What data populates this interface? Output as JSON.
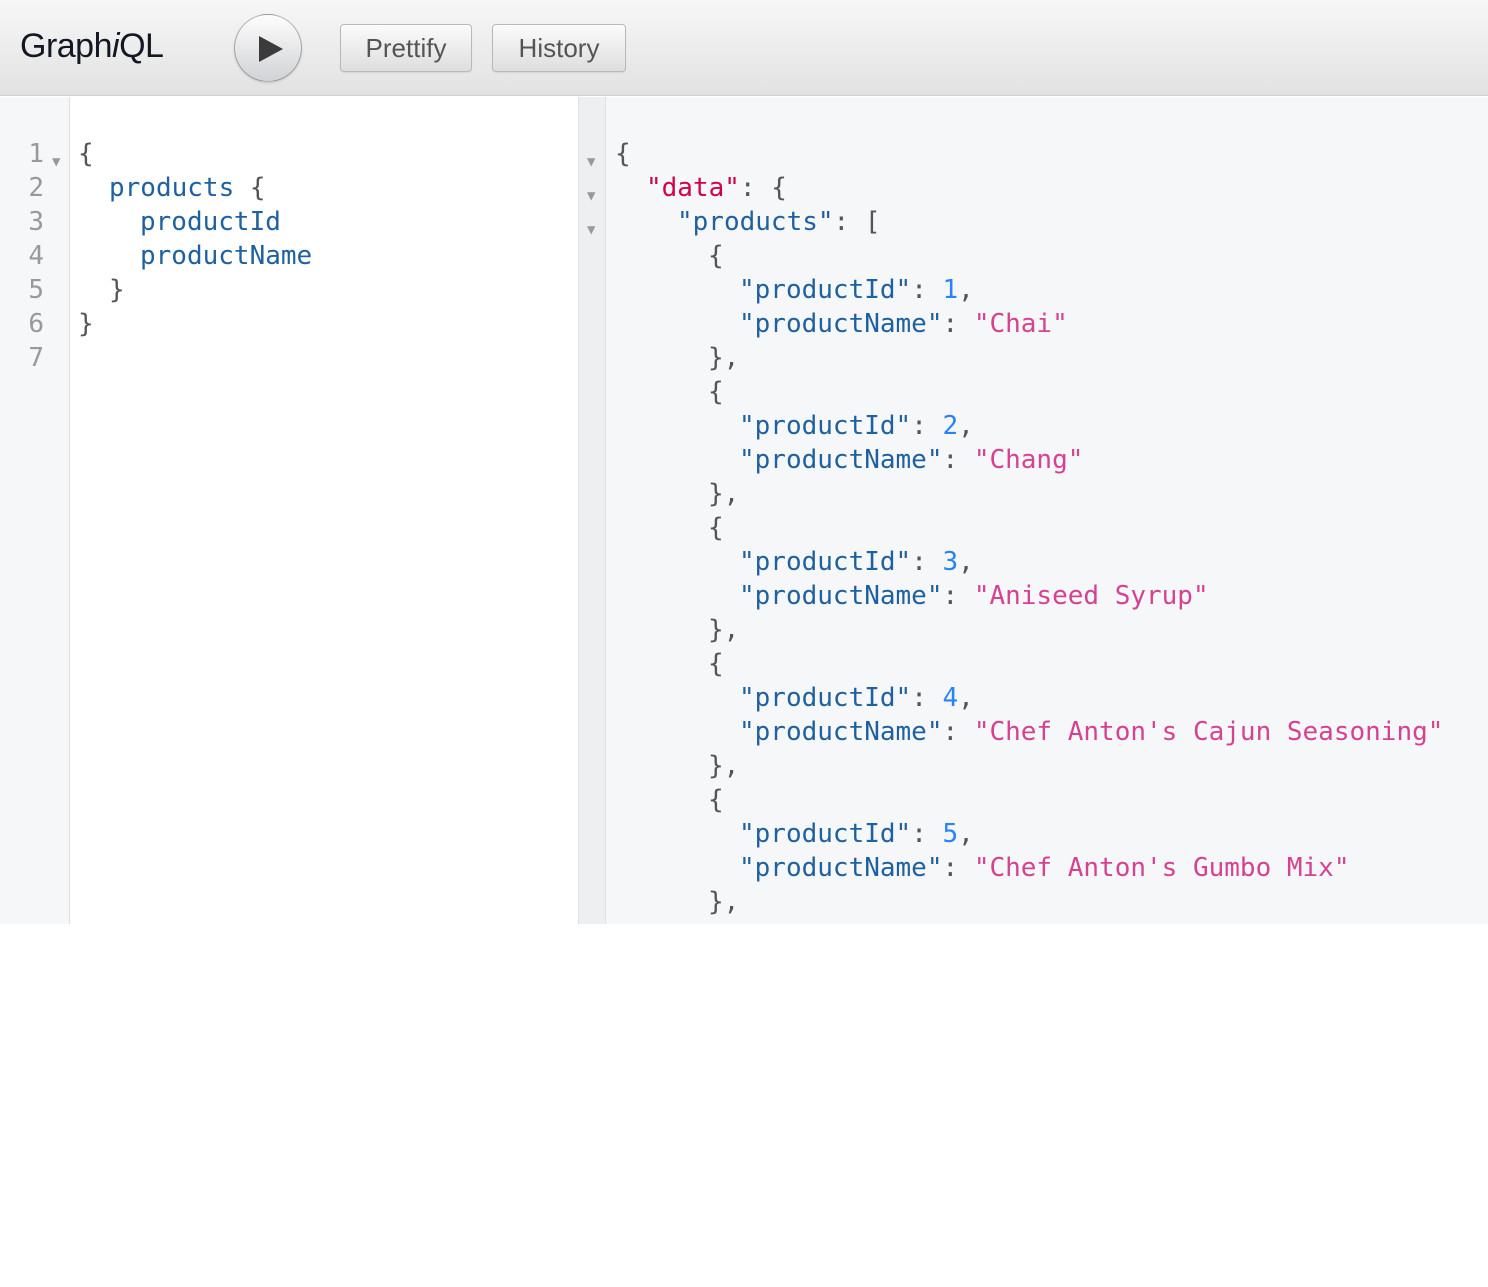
{
  "toolbar": {
    "logo_prefix": "Graph",
    "logo_italic": "i",
    "logo_suffix": "QL",
    "execute_icon": "play-icon",
    "prettify_label": "Prettify",
    "history_label": "History"
  },
  "query_editor": {
    "line_numbers": [
      "1",
      "2",
      "3",
      "4",
      "5",
      "6",
      "7"
    ],
    "open_brace": "{",
    "query_field": "products",
    "field_1": "productId",
    "field_2": "productName",
    "close_brace": "}"
  },
  "result": {
    "data_key": "\"data\"",
    "products_key": "\"products\"",
    "id_key": "\"productId\"",
    "name_key": "\"productName\"",
    "items": [
      {
        "id": "1",
        "name": "\"Chai\""
      },
      {
        "id": "2",
        "name": "\"Chang\""
      },
      {
        "id": "3",
        "name": "\"Aniseed Syrup\""
      },
      {
        "id": "4",
        "name": "\"Chef Anton's Cajun Seasoning\""
      },
      {
        "id": "5",
        "name": "\"Chef Anton's Gumbo Mix\""
      }
    ]
  },
  "colors": {
    "field": "#1f61a0",
    "data_key": "#d0024b",
    "number": "#2882f9",
    "string": "#d64292"
  }
}
